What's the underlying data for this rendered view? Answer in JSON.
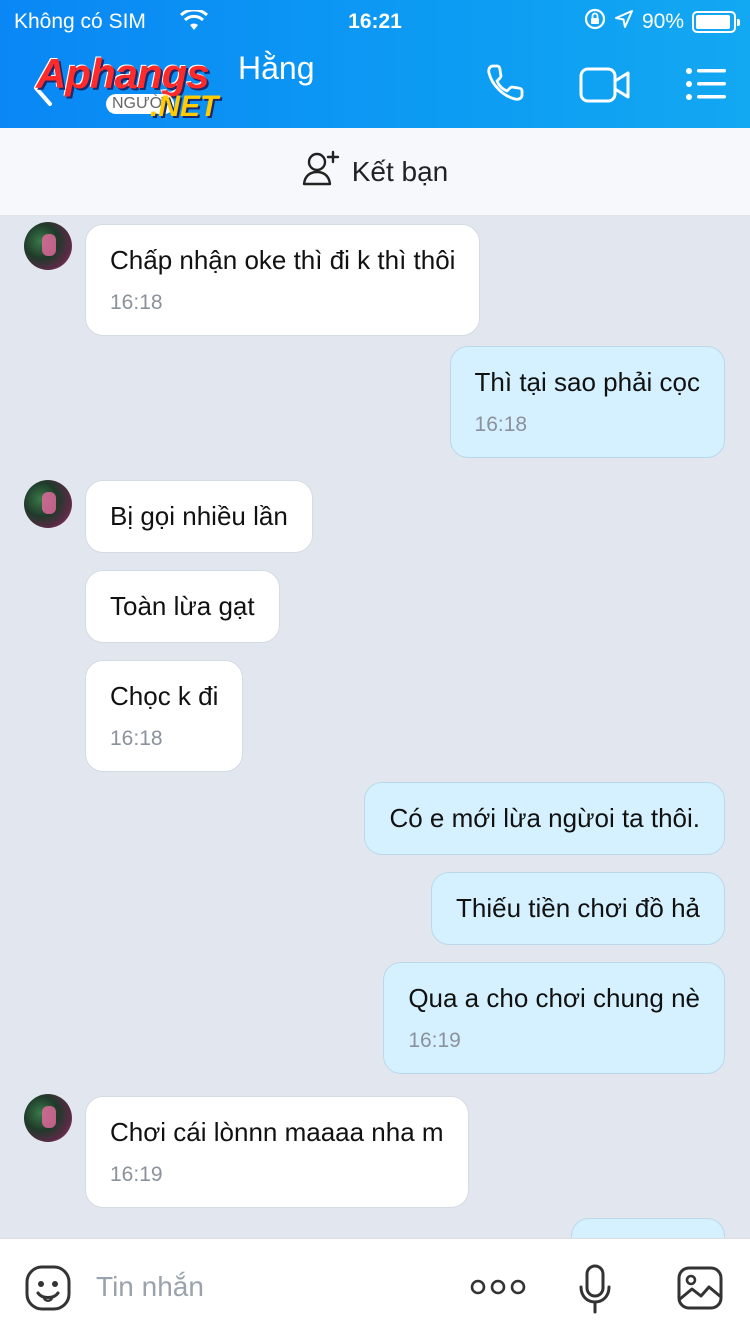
{
  "status_bar": {
    "carrier": "Không có SIM",
    "time": "16:21",
    "battery": "90%"
  },
  "header": {
    "contact_name": "Hằng",
    "watermark_brand": "Aphangs",
    "watermark_domain": ".NET",
    "watermark_tag": "NGƯỜI",
    "icons": [
      "back-icon",
      "phone-icon",
      "video-call-icon",
      "menu-icon"
    ],
    "accent_color": "#0a8ff4"
  },
  "friend_bar": {
    "label": "Kết bạn",
    "icon": "add-friend-icon"
  },
  "messages": [
    {
      "side": "in",
      "text": "Chấp nhận oke thì đi k thì thôi",
      "time": "16:18"
    },
    {
      "side": "out",
      "text": "Thì tại sao phải cọc",
      "time": "16:18"
    },
    {
      "side": "in",
      "text": "Bị gọi nhiều lần",
      "time": ""
    },
    {
      "side": "in",
      "text": "Toàn lừa gạt",
      "time": ""
    },
    {
      "side": "in",
      "text": "Chọc k đi",
      "time": "16:18"
    },
    {
      "side": "out",
      "text": "Có e mới lừa ngừoi ta thôi.",
      "time": ""
    },
    {
      "side": "out",
      "text": "Thiếu tiền chơi đồ hả",
      "time": ""
    },
    {
      "side": "out",
      "text": "Qua a cho chơi chung nè",
      "time": "16:19"
    },
    {
      "side": "in",
      "text": "Chơi cái lònnn maaaa nha m",
      "time": "16:19"
    }
  ],
  "composer": {
    "placeholder": "Tin nhắn",
    "icons": [
      "emoji-icon",
      "more-icon",
      "microphone-icon",
      "image-icon"
    ]
  }
}
